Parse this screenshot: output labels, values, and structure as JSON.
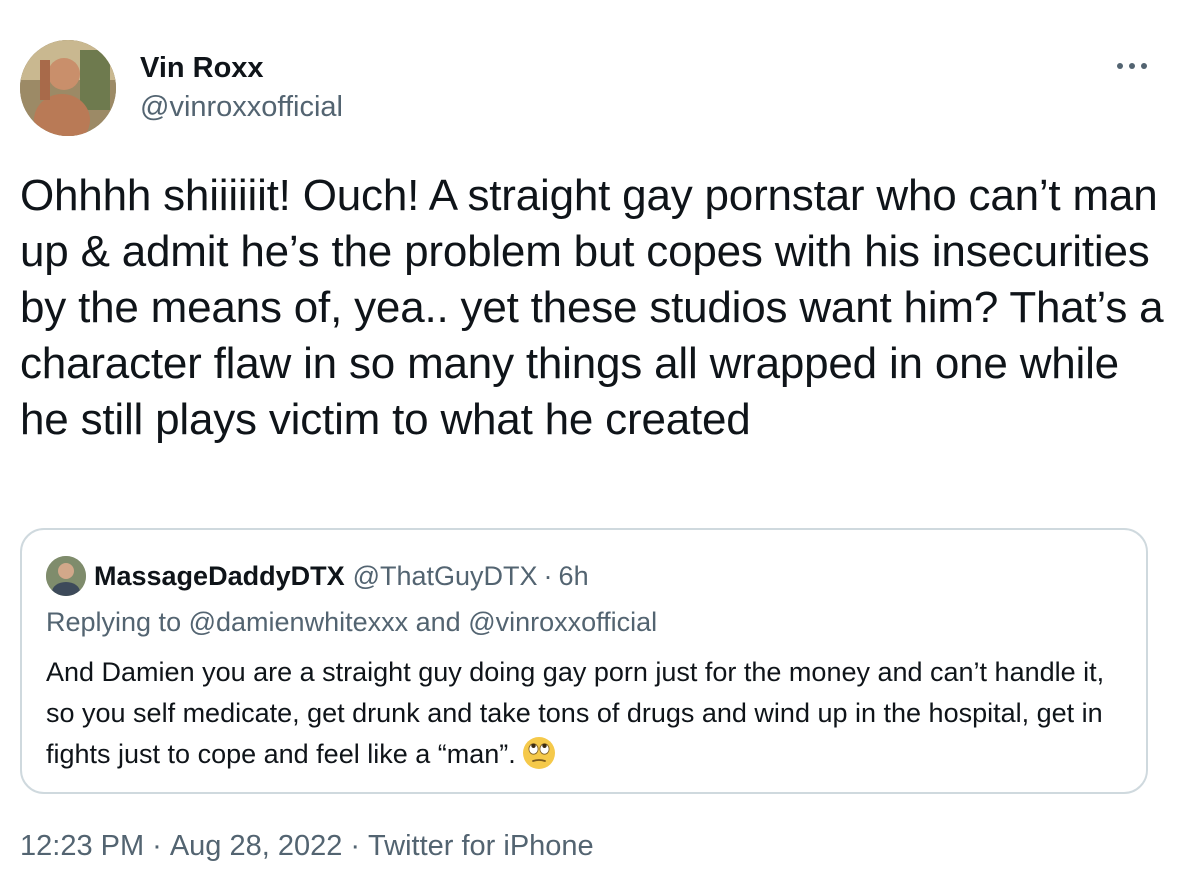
{
  "author": {
    "display_name": "Vin Roxx",
    "handle": "@vinroxxofficial",
    "avatar": "profile-photo"
  },
  "more_icon": "more-horizontal-icon",
  "tweet": {
    "text": "Ohhhh shiiiiiit! Ouch! A straight gay pornstar who can’t man up & admit he’s the problem but copes with his insecurities by the means of, yea.. yet these studios want him? That’s a character flaw in so many things all wrapped in one while he still plays victim to what he created"
  },
  "quoted_tweet": {
    "display_name": "MassageDaddyDTX",
    "handle": "@ThatGuyDTX",
    "dot": "·",
    "time": "6h",
    "replying_prefix": "Replying to",
    "replying_user1": "@damienwhitexxx",
    "replying_and": "and",
    "replying_user2": "@vinroxxofficial",
    "text": "And Damien you are a straight guy doing gay porn just for the money and can’t handle it, so you self medicate, get drunk and take tons of drugs and wind up in the hospital, get in fights just to cope and feel like a “man”.",
    "emoji": "face-with-rolling-eyes"
  },
  "footer": {
    "time": "12:23 PM",
    "sep": "·",
    "date": "Aug 28, 2022",
    "source": "Twitter for iPhone"
  }
}
